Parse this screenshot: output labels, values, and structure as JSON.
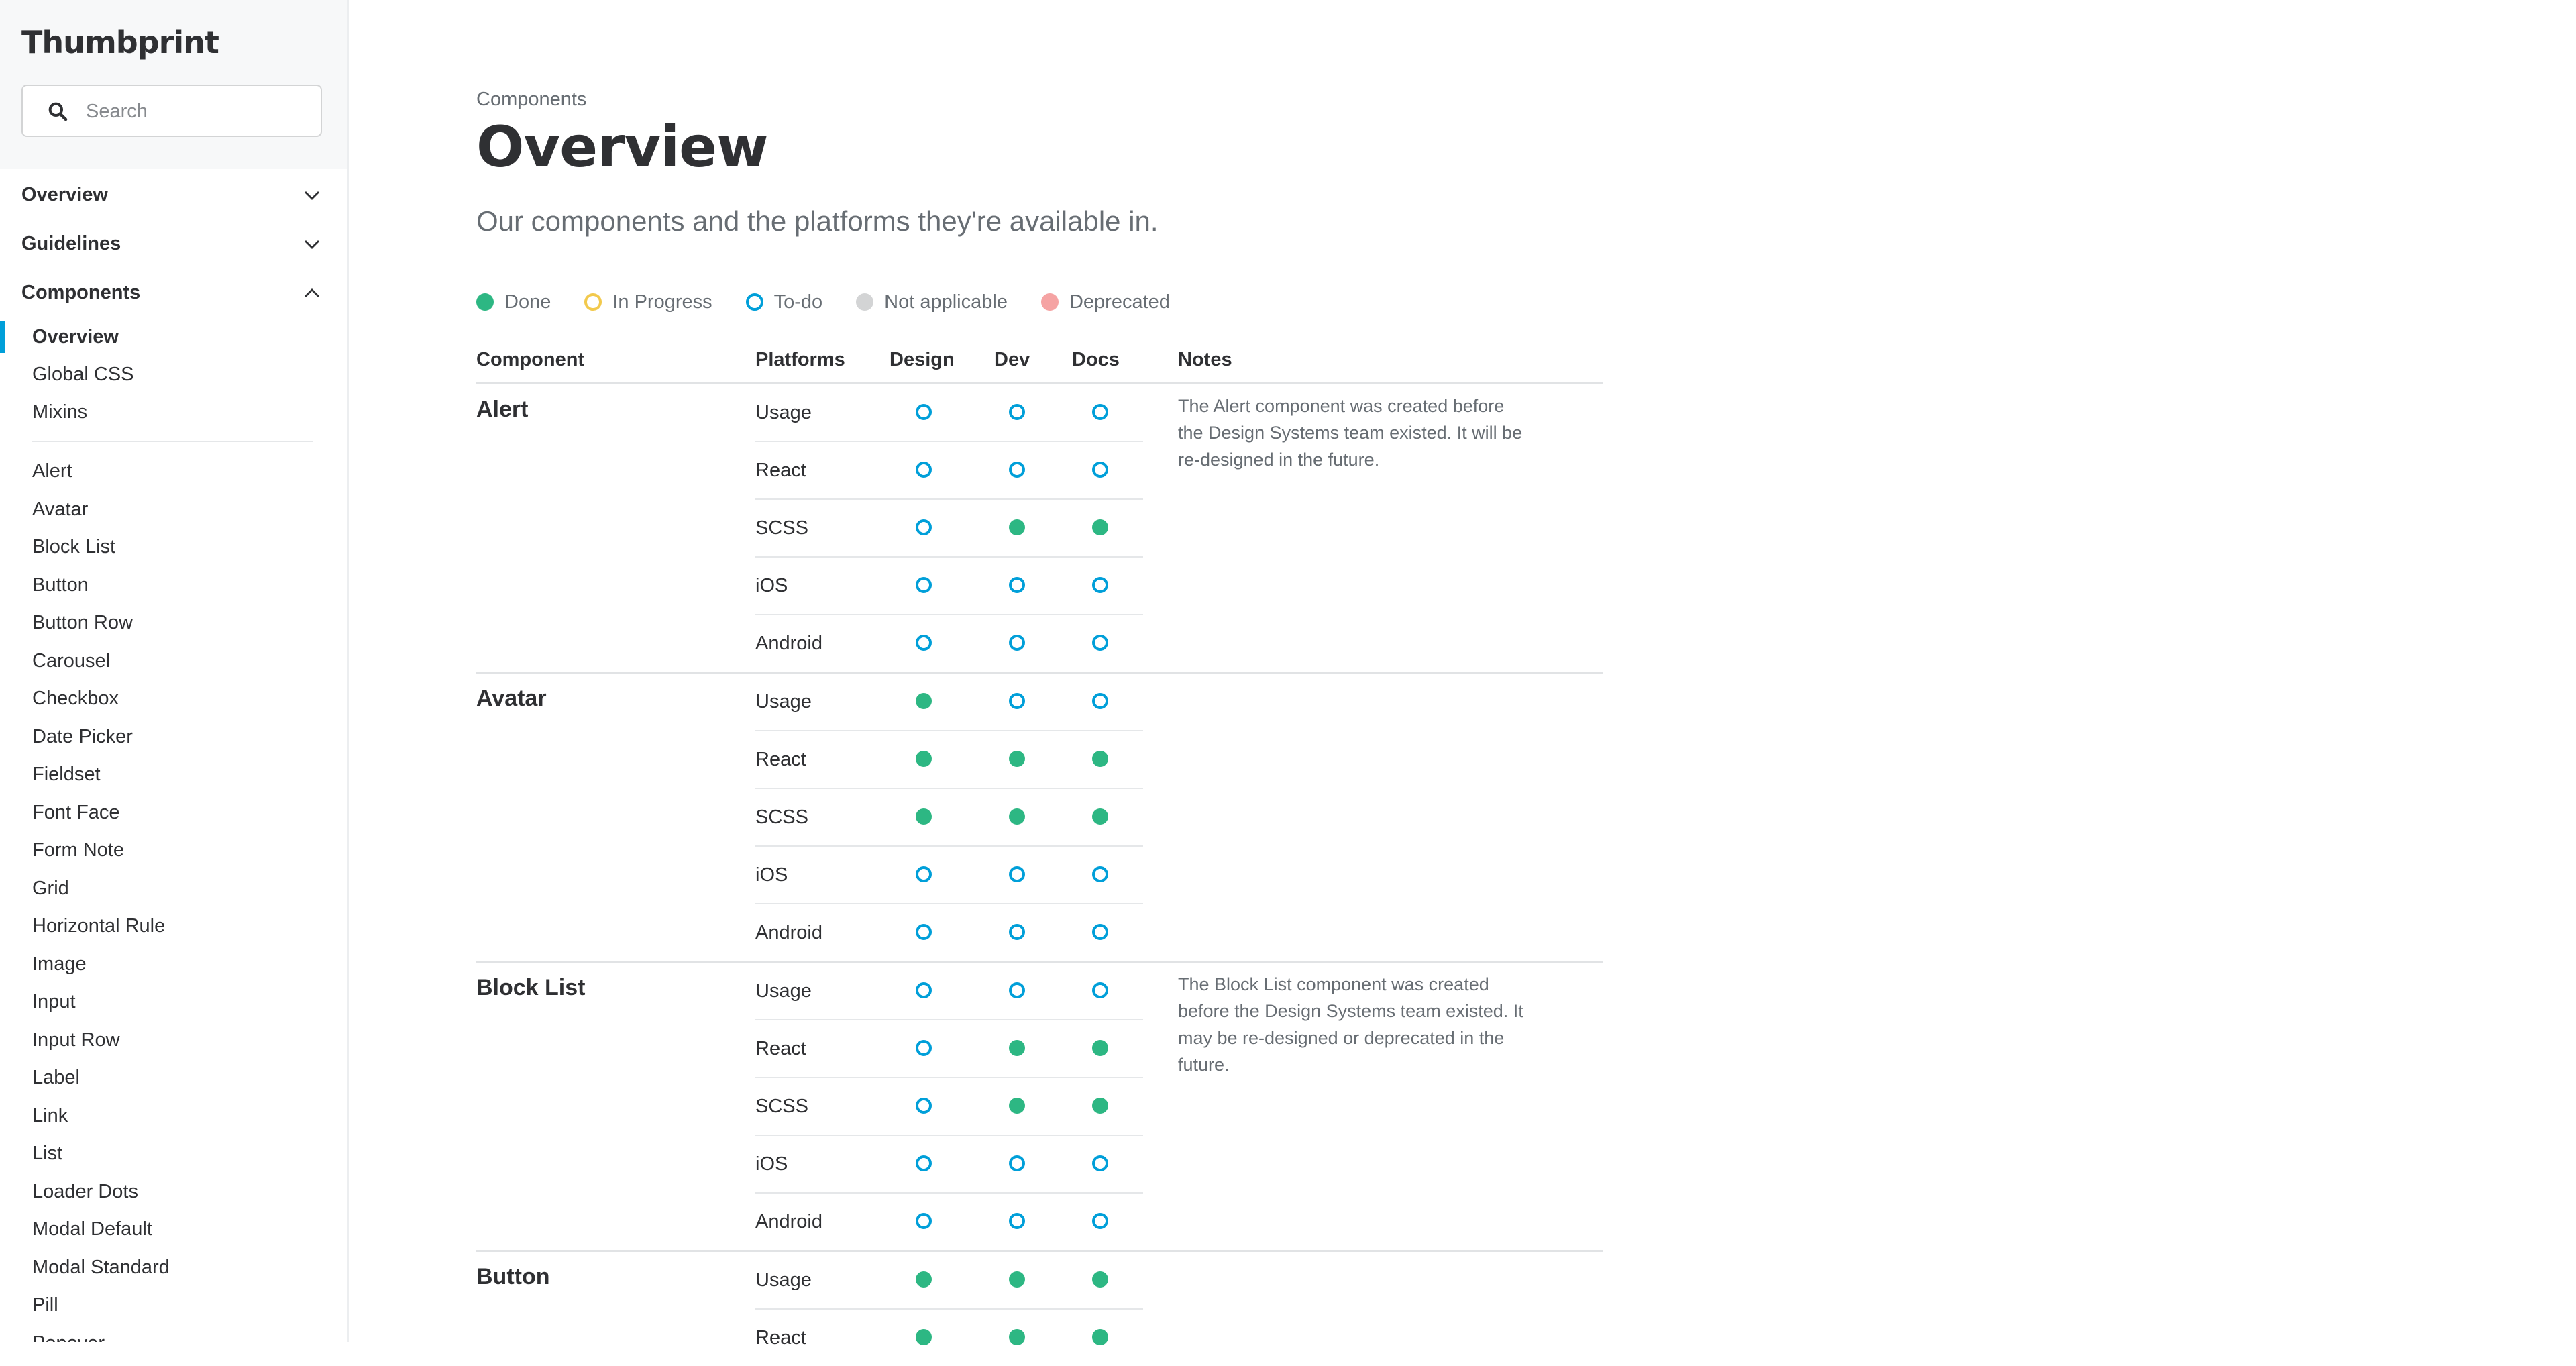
{
  "app": {
    "logo": "Thumbprint"
  },
  "search": {
    "placeholder": "Search"
  },
  "sidebar": {
    "sections": [
      {
        "label": "Overview",
        "expanded": false
      },
      {
        "label": "Guidelines",
        "expanded": false
      },
      {
        "label": "Components",
        "expanded": true
      }
    ],
    "subitems": [
      "Overview",
      "Global CSS",
      "Mixins"
    ],
    "active_item": "Overview",
    "components": [
      "Alert",
      "Avatar",
      "Block List",
      "Button",
      "Button Row",
      "Carousel",
      "Checkbox",
      "Date Picker",
      "Fieldset",
      "Font Face",
      "Form Note",
      "Grid",
      "Horizontal Rule",
      "Image",
      "Input",
      "Input Row",
      "Label",
      "Link",
      "List",
      "Loader Dots",
      "Modal Default",
      "Modal Standard",
      "Pill",
      "Popover"
    ]
  },
  "header": {
    "breadcrumb": "Components",
    "title": "Overview",
    "subtitle": "Our components and the platforms they're available in."
  },
  "colors": {
    "done": "#2db783",
    "in_progress": "#f2c94c",
    "todo": "#009fd9",
    "not_applicable": "#d3d4d5",
    "deprecated": "#f5a3a3",
    "accent": "#009fd9"
  },
  "legend": [
    {
      "label": "Done",
      "status": "done"
    },
    {
      "label": "In Progress",
      "status": "in_progress"
    },
    {
      "label": "To-do",
      "status": "todo"
    },
    {
      "label": "Not applicable",
      "status": "not_applicable"
    },
    {
      "label": "Deprecated",
      "status": "deprecated"
    }
  ],
  "table": {
    "headers": {
      "component": "Component",
      "platforms": "Platforms",
      "design": "Design",
      "dev": "Dev",
      "docs": "Docs",
      "notes": "Notes"
    },
    "groups": [
      {
        "name": "Alert",
        "note": "The Alert component was created before the Design Systems team existed. It will be re-designed in the future.",
        "rows": [
          {
            "platform": "Usage",
            "design": "todo",
            "dev": "todo",
            "docs": "todo"
          },
          {
            "platform": "React",
            "design": "todo",
            "dev": "todo",
            "docs": "todo"
          },
          {
            "platform": "SCSS",
            "design": "todo",
            "dev": "done",
            "docs": "done"
          },
          {
            "platform": "iOS",
            "design": "todo",
            "dev": "todo",
            "docs": "todo"
          },
          {
            "platform": "Android",
            "design": "todo",
            "dev": "todo",
            "docs": "todo"
          }
        ]
      },
      {
        "name": "Avatar",
        "note": "",
        "rows": [
          {
            "platform": "Usage",
            "design": "done",
            "dev": "todo",
            "docs": "todo"
          },
          {
            "platform": "React",
            "design": "done",
            "dev": "done",
            "docs": "done"
          },
          {
            "platform": "SCSS",
            "design": "done",
            "dev": "done",
            "docs": "done"
          },
          {
            "platform": "iOS",
            "design": "todo",
            "dev": "todo",
            "docs": "todo"
          },
          {
            "platform": "Android",
            "design": "todo",
            "dev": "todo",
            "docs": "todo"
          }
        ]
      },
      {
        "name": "Block List",
        "note": "The Block List component was created before the Design Systems team existed. It may be re-designed or deprecated in the future.",
        "rows": [
          {
            "platform": "Usage",
            "design": "todo",
            "dev": "todo",
            "docs": "todo"
          },
          {
            "platform": "React",
            "design": "todo",
            "dev": "done",
            "docs": "done"
          },
          {
            "platform": "SCSS",
            "design": "todo",
            "dev": "done",
            "docs": "done"
          },
          {
            "platform": "iOS",
            "design": "todo",
            "dev": "todo",
            "docs": "todo"
          },
          {
            "platform": "Android",
            "design": "todo",
            "dev": "todo",
            "docs": "todo"
          }
        ]
      },
      {
        "name": "Button",
        "note": "",
        "rows": [
          {
            "platform": "Usage",
            "design": "done",
            "dev": "done",
            "docs": "done"
          },
          {
            "platform": "React",
            "design": "done",
            "dev": "done",
            "docs": "done"
          }
        ]
      }
    ]
  }
}
